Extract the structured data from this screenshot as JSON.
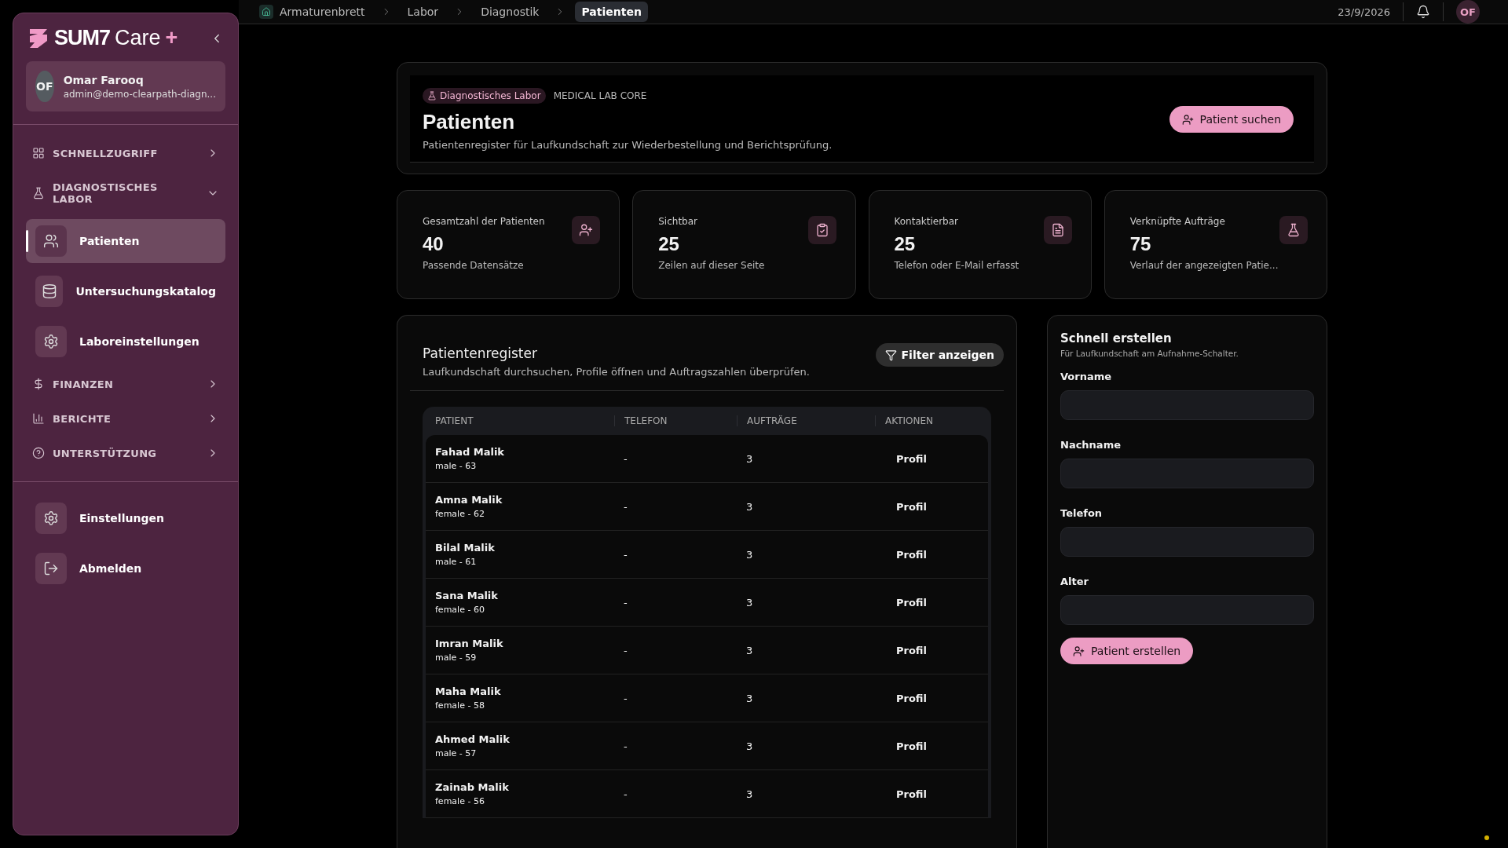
{
  "sidebar": {
    "brand": {
      "mark": "SUM7",
      "product": "Care",
      "suffix": "+"
    },
    "user": {
      "initials": "OF",
      "name": "Omar Farooq",
      "email": "admin@demo-clearpath-diagn..."
    },
    "sections": [
      {
        "label": "SCHNELLZUGRIFF",
        "expanded": false
      },
      {
        "label": "DIAGNOSTISCHES LABOR",
        "expanded": true,
        "children": [
          {
            "label": "Patienten",
            "selected": true
          },
          {
            "label": "Untersuchungskatalog",
            "selected": false
          },
          {
            "label": "Laboreinstellungen",
            "selected": false
          }
        ]
      },
      {
        "label": "FINANZEN",
        "expanded": false
      },
      {
        "label": "BERICHTE",
        "expanded": false
      },
      {
        "label": "UNTERSTÜTZUNG",
        "expanded": false
      }
    ],
    "footer_items": [
      {
        "label": "Einstellungen"
      },
      {
        "label": "Abmelden"
      }
    ]
  },
  "topbar": {
    "breadcrumbs": [
      {
        "label": "Armaturenbrett",
        "selected": false
      },
      {
        "label": "Labor",
        "selected": false
      },
      {
        "label": "Diagnostik",
        "selected": false
      },
      {
        "label": "Patienten",
        "selected": true
      }
    ],
    "date": "23/9/2026",
    "avatar": "OF"
  },
  "header": {
    "badge": "Diagnostisches Labor",
    "eyebrow": "MEDICAL LAB CORE",
    "title": "Patienten",
    "subtitle": "Patientenregister für Laufkundschaft zur Wiederbestellung und Berichtsprüfung.",
    "action": "Patient suchen"
  },
  "stats": [
    {
      "label": "Gesamtzahl der Patienten",
      "value": "40",
      "note": "Passende Datensätze"
    },
    {
      "label": "Sichtbar",
      "value": "25",
      "note": "Zeilen auf dieser Seite"
    },
    {
      "label": "Kontaktierbar",
      "value": "25",
      "note": "Telefon oder E-Mail erfasst"
    },
    {
      "label": "Verknüpfte Aufträge",
      "value": "75",
      "note": "Verlauf der angezeigten Patie..."
    }
  ],
  "register": {
    "title": "Patientenregister",
    "subtitle": "Laufkundschaft durchsuchen, Profile öffnen und Auftragszahlen überprüfen.",
    "filter": "Filter anzeigen",
    "columns": [
      "PATIENT",
      "TELEFON",
      "AUFTRÄGE",
      "AKTIONEN"
    ],
    "rows": [
      {
        "name": "Fahad Malik",
        "meta": "male - 63",
        "phone": "-",
        "orders": "3",
        "action": "Profil"
      },
      {
        "name": "Amna Malik",
        "meta": "female - 62",
        "phone": "-",
        "orders": "3",
        "action": "Profil"
      },
      {
        "name": "Bilal Malik",
        "meta": "male - 61",
        "phone": "-",
        "orders": "3",
        "action": "Profil"
      },
      {
        "name": "Sana Malik",
        "meta": "female - 60",
        "phone": "-",
        "orders": "3",
        "action": "Profil"
      },
      {
        "name": "Imran Malik",
        "meta": "male - 59",
        "phone": "-",
        "orders": "3",
        "action": "Profil"
      },
      {
        "name": "Maha Malik",
        "meta": "female - 58",
        "phone": "-",
        "orders": "3",
        "action": "Profil"
      },
      {
        "name": "Ahmed Malik",
        "meta": "male - 57",
        "phone": "-",
        "orders": "3",
        "action": "Profil"
      },
      {
        "name": "Zainab Malik",
        "meta": "female - 56",
        "phone": "-",
        "orders": "3",
        "action": "Profil"
      }
    ]
  },
  "quick_create": {
    "title": "Schnell erstellen",
    "subtitle": "Für Laufkundschaft am Aufnahme-Schalter.",
    "fields": [
      {
        "label": "Vorname"
      },
      {
        "label": "Nachname"
      },
      {
        "label": "Telefon"
      },
      {
        "label": "Alter"
      }
    ],
    "submit": "Patient erstellen"
  }
}
